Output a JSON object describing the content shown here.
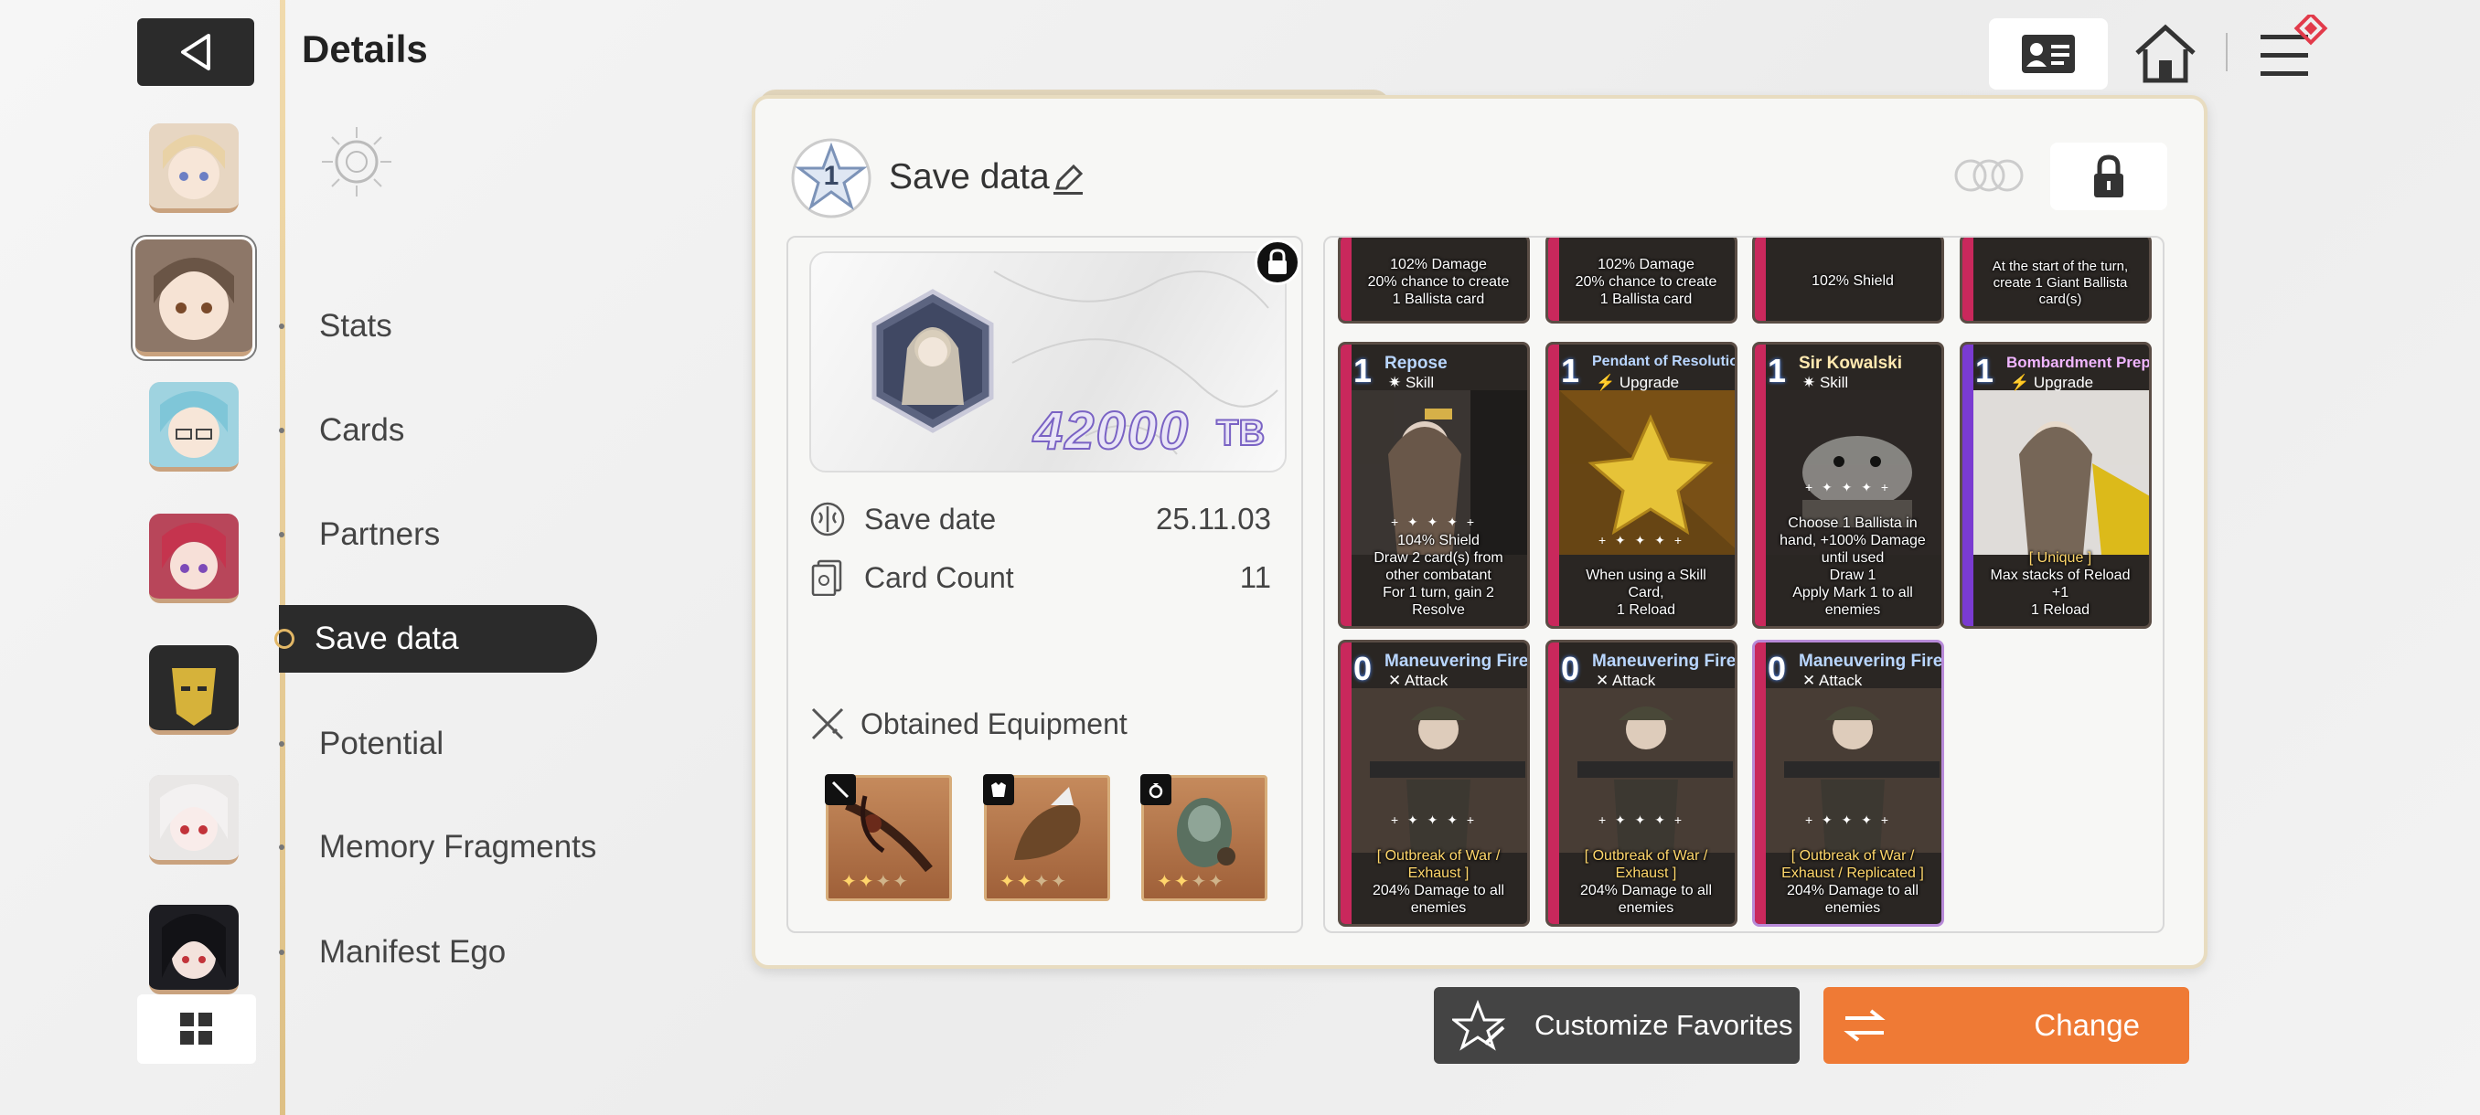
{
  "header": {
    "title": "Details"
  },
  "nav": {
    "items": [
      {
        "label": "Stats"
      },
      {
        "label": "Cards"
      },
      {
        "label": "Partners"
      },
      {
        "label": "Save data"
      },
      {
        "label": "Potential"
      },
      {
        "label": "Memory Fragments"
      },
      {
        "label": "Manifest Ego"
      }
    ],
    "active": "Save data"
  },
  "panel": {
    "slot_number": "1",
    "title": "Save data",
    "tb_value": "42000",
    "tb_unit": "TB",
    "save_date_label": "Save date",
    "save_date_value": "25.11.03",
    "card_count_label": "Card Count",
    "card_count_value": "11",
    "equipment_title": "Obtained Equipment",
    "equipment": [
      {
        "slot": "weapon",
        "stars": 2,
        "max_stars": 4
      },
      {
        "slot": "armor",
        "stars": 2,
        "max_stars": 4
      },
      {
        "slot": "ring",
        "stars": 2,
        "max_stars": 4
      }
    ]
  },
  "cards": {
    "row0": [
      {
        "desc1": "102% Damage",
        "desc2": "20% chance to create",
        "desc3": "1 Ballista card"
      },
      {
        "desc1": "102% Damage",
        "desc2": "20% chance to create",
        "desc3": "1 Ballista card"
      },
      {
        "desc1": "102% Shield",
        "desc2": "",
        "desc3": ""
      },
      {
        "desc1": "Create 1 Giant Ballista",
        "desc2": "At the start of the turn, create 1 Giant Ballista",
        "desc3": "card(s)"
      }
    ],
    "row1": [
      {
        "cost": "1",
        "name": "Repose",
        "type": "Skill",
        "desc": [
          "104% Shield",
          "Draw 2 card(s) from",
          "other combatant",
          "For 1 turn, gain 2",
          "Resolve"
        ]
      },
      {
        "cost": "1",
        "name": "Pendant of Resolution",
        "type": "Upgrade",
        "desc": [
          "When using a Skill",
          "Card,",
          "1 Reload"
        ]
      },
      {
        "cost": "1",
        "name": "Sir Kowalski",
        "type": "Skill",
        "desc": [
          "Choose 1 Ballista in",
          "hand, +100% Damage",
          "until used",
          "Draw 1",
          "Apply Mark 1 to all",
          "enemies"
        ]
      },
      {
        "cost": "1",
        "name": "Bombardment Prep",
        "type": "Upgrade",
        "desc": [
          "[ Unique ]",
          "Max stacks of Reload",
          "+1",
          "1 Reload"
        ]
      }
    ],
    "row2": [
      {
        "cost": "0",
        "name": "Maneuvering Fire",
        "type": "Attack",
        "desc": [
          "[ Outbreak of War /",
          "Exhaust ]",
          "204% Damage to all",
          "enemies"
        ]
      },
      {
        "cost": "0",
        "name": "Maneuvering Fire",
        "type": "Attack",
        "desc": [
          "[ Outbreak of War /",
          "Exhaust ]",
          "204% Damage to all",
          "enemies"
        ]
      },
      {
        "cost": "0",
        "name": "Maneuvering Fire",
        "type": "Attack",
        "desc": [
          "[ Outbreak of War /",
          "Exhaust / Replicated ]",
          "204% Damage to all",
          "enemies"
        ]
      }
    ]
  },
  "buttons": {
    "favorites": "Customize Favorites",
    "change": "Change"
  },
  "icons": [
    "back-arrow-icon",
    "profile-card-icon",
    "home-icon",
    "menu-icon",
    "lock-icon",
    "pencil-icon",
    "grid-icon",
    "brain-icon",
    "card-stack-icon",
    "crossed-swords-icon",
    "swap-icon",
    "star-edit-icon"
  ],
  "colors": {
    "accent": "#ef7a35",
    "dark": "#2b2b2b",
    "gold": "#e2b766",
    "tb_purple": "#7a63c4",
    "card_bar": "#c9285c"
  }
}
